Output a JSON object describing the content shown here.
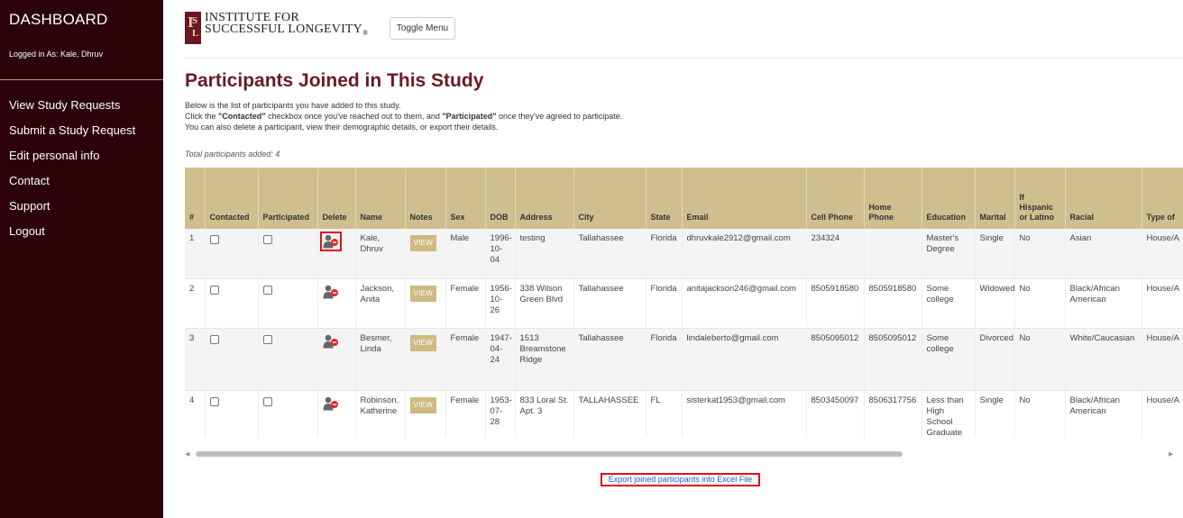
{
  "sidebar": {
    "title": "DASHBOARD",
    "logged_in": "Logged in As: Kale, Dhruv",
    "menu": [
      "View Study Requests",
      "Submit a Study Request",
      "Edit personal info",
      "Contact",
      "Support",
      "Logout"
    ]
  },
  "header": {
    "logo_line1": "INSTITUTE FOR",
    "logo_line2": "SUCCESSFUL LONGEVITY",
    "logo_reg": "®",
    "logo_mark": [
      "I",
      "S",
      "L"
    ],
    "toggle_label": "Toggle Menu"
  },
  "main": {
    "title": "Participants Joined in This Study",
    "intro_line1": "Below is the list of participants you have added to this study.",
    "intro_line2_a": "Click the ",
    "intro_line2_b": "\"Contacted\"",
    "intro_line2_c": " checkbox once you've reached out to them, and ",
    "intro_line2_d": "\"Participated\"",
    "intro_line2_e": " once they've agreed to participate.",
    "intro_line3": "You can also delete a participant, view their demographic details, or export their details.",
    "total": "Total participants added: 4",
    "view_label": "VIEW",
    "export_label": "Export joined participants into Excel File"
  },
  "table": {
    "headers": [
      "#",
      "Contacted",
      "Participated",
      "Delete",
      "Name",
      "Notes",
      "Sex",
      "DOB",
      "Address",
      "City",
      "State",
      "Email",
      "Cell Phone",
      "Home Phone",
      "Education",
      "Marital",
      "If Hispanic or Latino",
      "Racial",
      "Type of"
    ],
    "rows": [
      {
        "num": "1",
        "name": "Kale, Dhruv",
        "sex": "Male",
        "dob": "1996-10-04",
        "address": "testing",
        "city": "Tallahassee",
        "state": "Florida",
        "email": "dhruvkale2912@gmail.com",
        "cell": "234324",
        "home": "",
        "education": "Master's Degree",
        "marital": "Single",
        "hispanic": "No",
        "racial": "Asian",
        "type": "House/A"
      },
      {
        "num": "2",
        "name": "Jackson, Anita",
        "sex": "Female",
        "dob": "1956-10-26",
        "address": "338 Wilson Green Blvd",
        "city": "Tallahassee",
        "state": "Florida",
        "email": "anitajackson246@gmail.com",
        "cell": "8505918580",
        "home": "8505918580",
        "education": "Some college",
        "marital": "Widowed",
        "hispanic": "No",
        "racial": "Black/African American",
        "type": "House/A"
      },
      {
        "num": "3",
        "name": "Besmer, Linda",
        "sex": "Female",
        "dob": "1947-04-24",
        "address": "1513 Breamstone Ridge",
        "city": "Tallahassee",
        "state": "Florida",
        "email": "lindaleberto@gmail.com",
        "cell": "8505095012",
        "home": "8505095012",
        "education": "Some college",
        "marital": "Divorced",
        "hispanic": "No",
        "racial": "White/Caucasian",
        "type": "House/A"
      },
      {
        "num": "4",
        "name": "Robinson, Katherine",
        "sex": "Female",
        "dob": "1953-07-28",
        "address": "833 Loral St. Apt. 3",
        "city": "TALLAHASSEE",
        "state": "FL",
        "email": "sisterkat1953@gmail.com",
        "cell": "8503450097",
        "home": "8506317756",
        "education": "Less than High School Graduate",
        "marital": "Single",
        "hispanic": "No",
        "racial": "Black/African American",
        "type": "House/A"
      }
    ]
  },
  "scrollbar": {
    "left_arrow": "◀",
    "right_arrow": "▶"
  },
  "colors": {
    "sidebar_bg": "#2b0308",
    "title": "#6b1a26",
    "table_header": "#d0bf8e",
    "view_button": "#cfba84",
    "highlight": "#e0101a",
    "link": "#1a5bd6"
  }
}
